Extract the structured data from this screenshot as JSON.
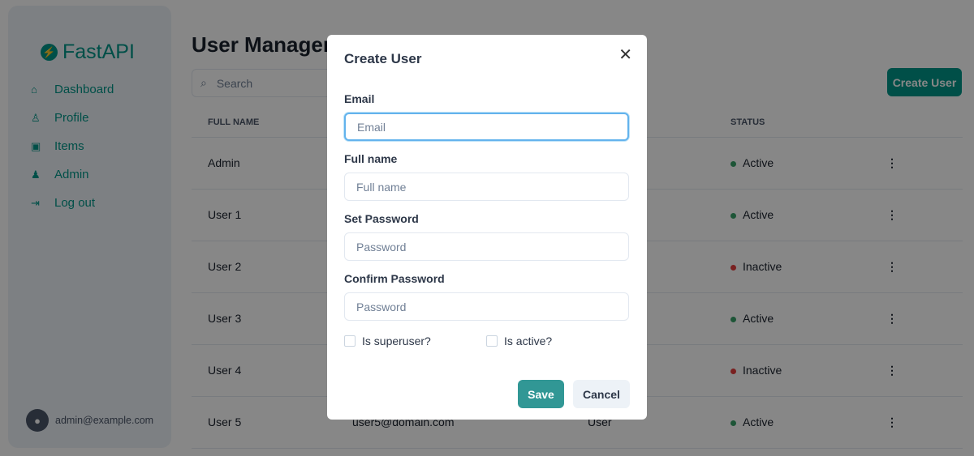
{
  "sidebar": {
    "logo": "FastAPI",
    "items": [
      {
        "label": "Dashboard",
        "icon": "home-icon"
      },
      {
        "label": "Profile",
        "icon": "user-icon"
      },
      {
        "label": "Items",
        "icon": "briefcase-icon"
      },
      {
        "label": "Admin",
        "icon": "users-icon"
      },
      {
        "label": "Log out",
        "icon": "logout-icon"
      }
    ],
    "user_email": "admin@example.com"
  },
  "main": {
    "title": "User Management",
    "search_placeholder": "Search",
    "create_button": "Create User",
    "columns": {
      "full_name": "FULL NAME",
      "status": "STATUS"
    },
    "rows": [
      {
        "name": "Admin",
        "email": "",
        "role": "",
        "status": "Active"
      },
      {
        "name": "User 1",
        "email": "",
        "role": "",
        "status": "Active"
      },
      {
        "name": "User 2",
        "email": "",
        "role": "",
        "status": "Inactive"
      },
      {
        "name": "User 3",
        "email": "",
        "role": "",
        "status": "Active"
      },
      {
        "name": "User 4",
        "email": "",
        "role": "",
        "status": "Inactive"
      },
      {
        "name": "User 5",
        "email": "user5@domain.com",
        "role": "User",
        "status": "Active"
      }
    ]
  },
  "colors": {
    "brand": "#009688",
    "active": "#38a169",
    "inactive": "#e53e3e"
  },
  "modal": {
    "title": "Create User",
    "email_label": "Email",
    "email_placeholder": "Email",
    "full_name_label": "Full name",
    "full_name_placeholder": "Full name",
    "password_label": "Set Password",
    "password_placeholder": "Password",
    "confirm_label": "Confirm Password",
    "confirm_placeholder": "Password",
    "superuser_label": "Is superuser?",
    "active_label": "Is active?",
    "save": "Save",
    "cancel": "Cancel"
  }
}
